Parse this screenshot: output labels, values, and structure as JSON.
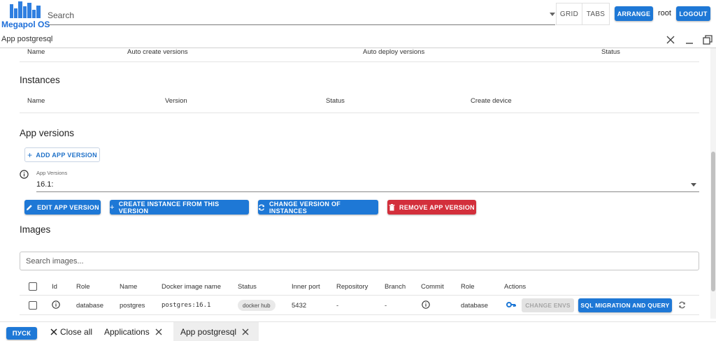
{
  "topbar": {
    "logo_text": "Megapol OS",
    "search_placeholder": "Search",
    "grid_label": "GRID",
    "tabs_label": "TABS",
    "arrange_label": "ARRANGE",
    "user": "root",
    "logout_label": "LOGOUT"
  },
  "window": {
    "title": "App postgresql"
  },
  "versions_table": {
    "headers": [
      "Name",
      "Auto create versions",
      "Auto deploy versions",
      "Status"
    ]
  },
  "instances": {
    "title": "Instances",
    "headers": [
      "Name",
      "Version",
      "Status",
      "Create device"
    ]
  },
  "app_versions": {
    "title": "App versions",
    "add_label": "ADD APP VERSION",
    "select_label": "App Versions",
    "select_value": "16.1:",
    "buttons": {
      "edit": "EDIT APP VERSION",
      "create_instance": "CREATE INSTANCE FROM THIS VERSION",
      "change_version": "CHANGE VERSION OF INSTANCES",
      "remove": "REMOVE APP VERSION"
    }
  },
  "images": {
    "title": "Images",
    "search_placeholder": "Search images...",
    "headers": [
      "Id",
      "Role",
      "Name",
      "Docker image name",
      "Status",
      "Inner port",
      "Repository",
      "Branch",
      "Commit",
      "Role",
      "Actions"
    ],
    "row": {
      "role": "database",
      "name": "postgres",
      "docker_image": "postgres:16.1",
      "status": "docker hub",
      "inner_port": "5432",
      "repository": "-",
      "branch": "-",
      "role2": "database",
      "change_envs": "CHANGE ENVS",
      "sql_migration": "SQL MIGRATION AND QUERY"
    }
  },
  "taskbar": {
    "start_label": "ПУСК",
    "close_all": "Close all",
    "tabs": [
      "Applications",
      "App postgresql"
    ]
  },
  "colors": {
    "primary": "#1e78d6",
    "danger": "#d32f3b",
    "logo": "#2f7fe0"
  }
}
